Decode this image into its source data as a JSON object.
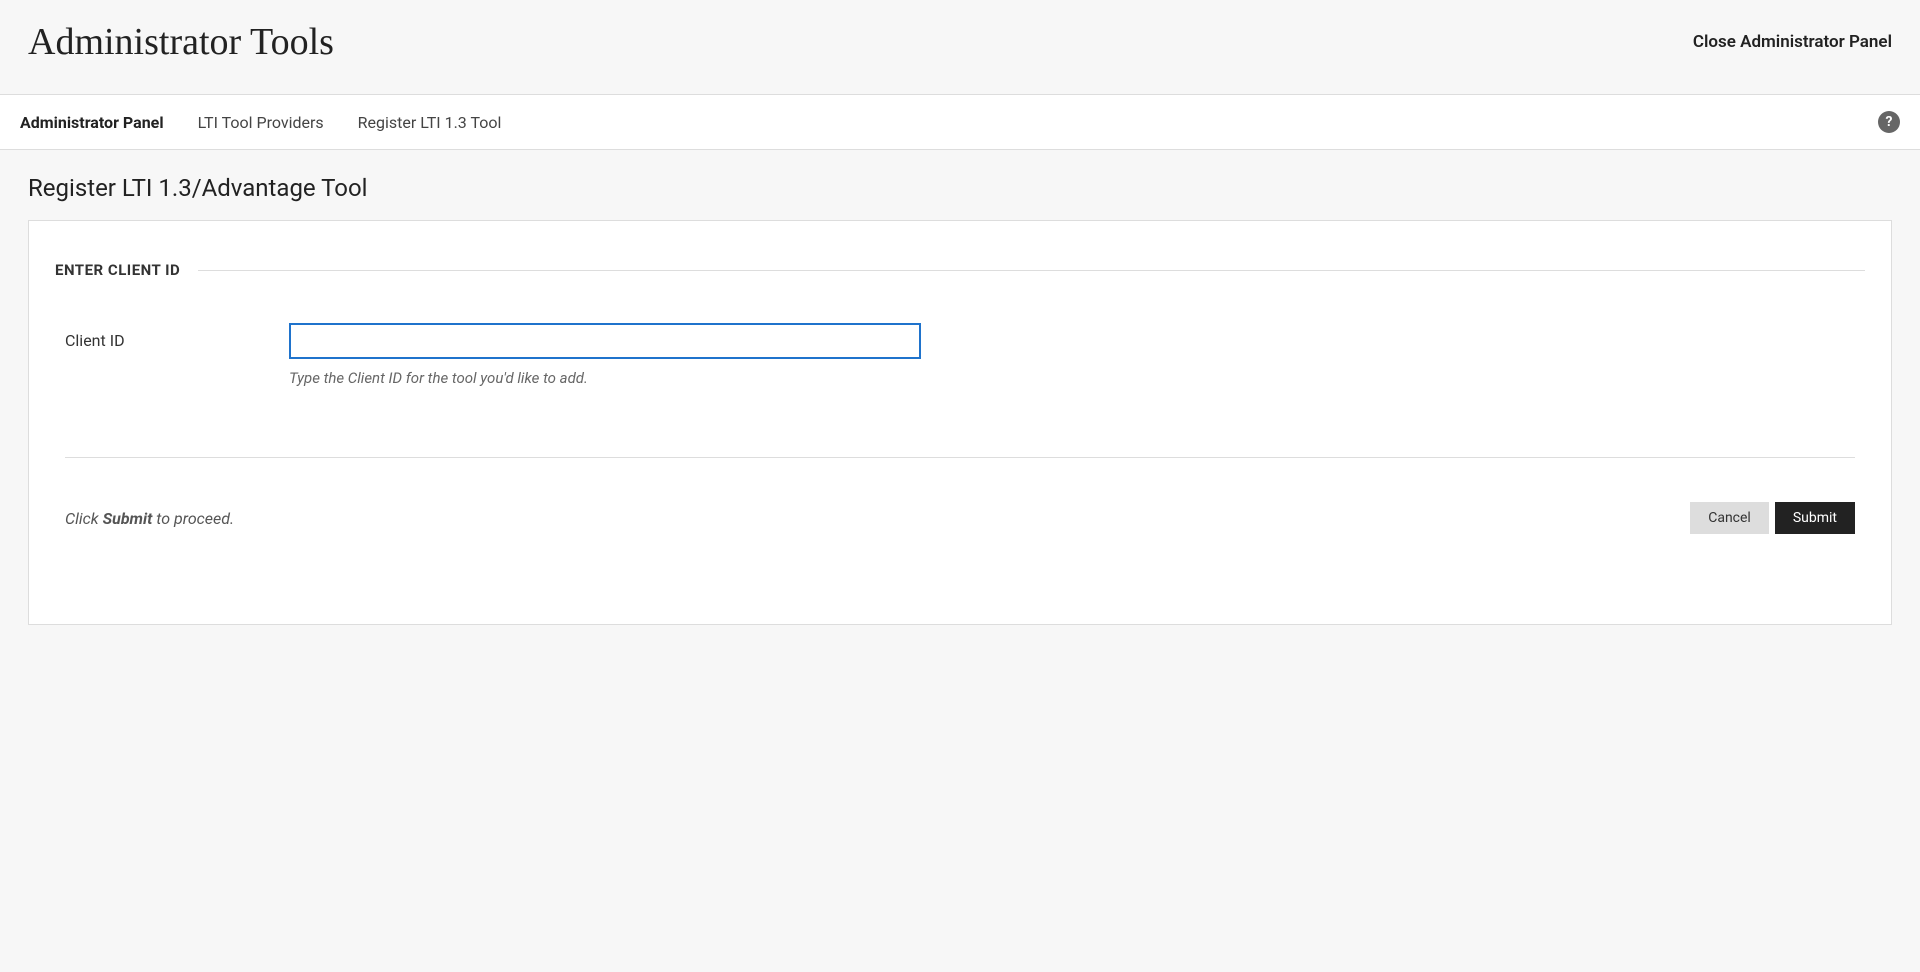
{
  "header": {
    "title": "Administrator Tools",
    "close_label": "Close Administrator Panel"
  },
  "breadcrumb": {
    "items": [
      {
        "label": "Administrator Panel",
        "active": true
      },
      {
        "label": "LTI Tool Providers",
        "active": false
      },
      {
        "label": "Register LTI 1.3 Tool",
        "active": false
      }
    ]
  },
  "help_icon_label": "?",
  "page": {
    "title": "Register LTI 1.3/Advantage Tool"
  },
  "form": {
    "section_header": "ENTER CLIENT ID",
    "client_id": {
      "label": "Client ID",
      "value": "",
      "hint": "Type the Client ID for the tool you'd like to add."
    },
    "footer_hint_prefix": "Click ",
    "footer_hint_strong": "Submit",
    "footer_hint_suffix": " to proceed.",
    "buttons": {
      "cancel": "Cancel",
      "submit": "Submit"
    }
  }
}
